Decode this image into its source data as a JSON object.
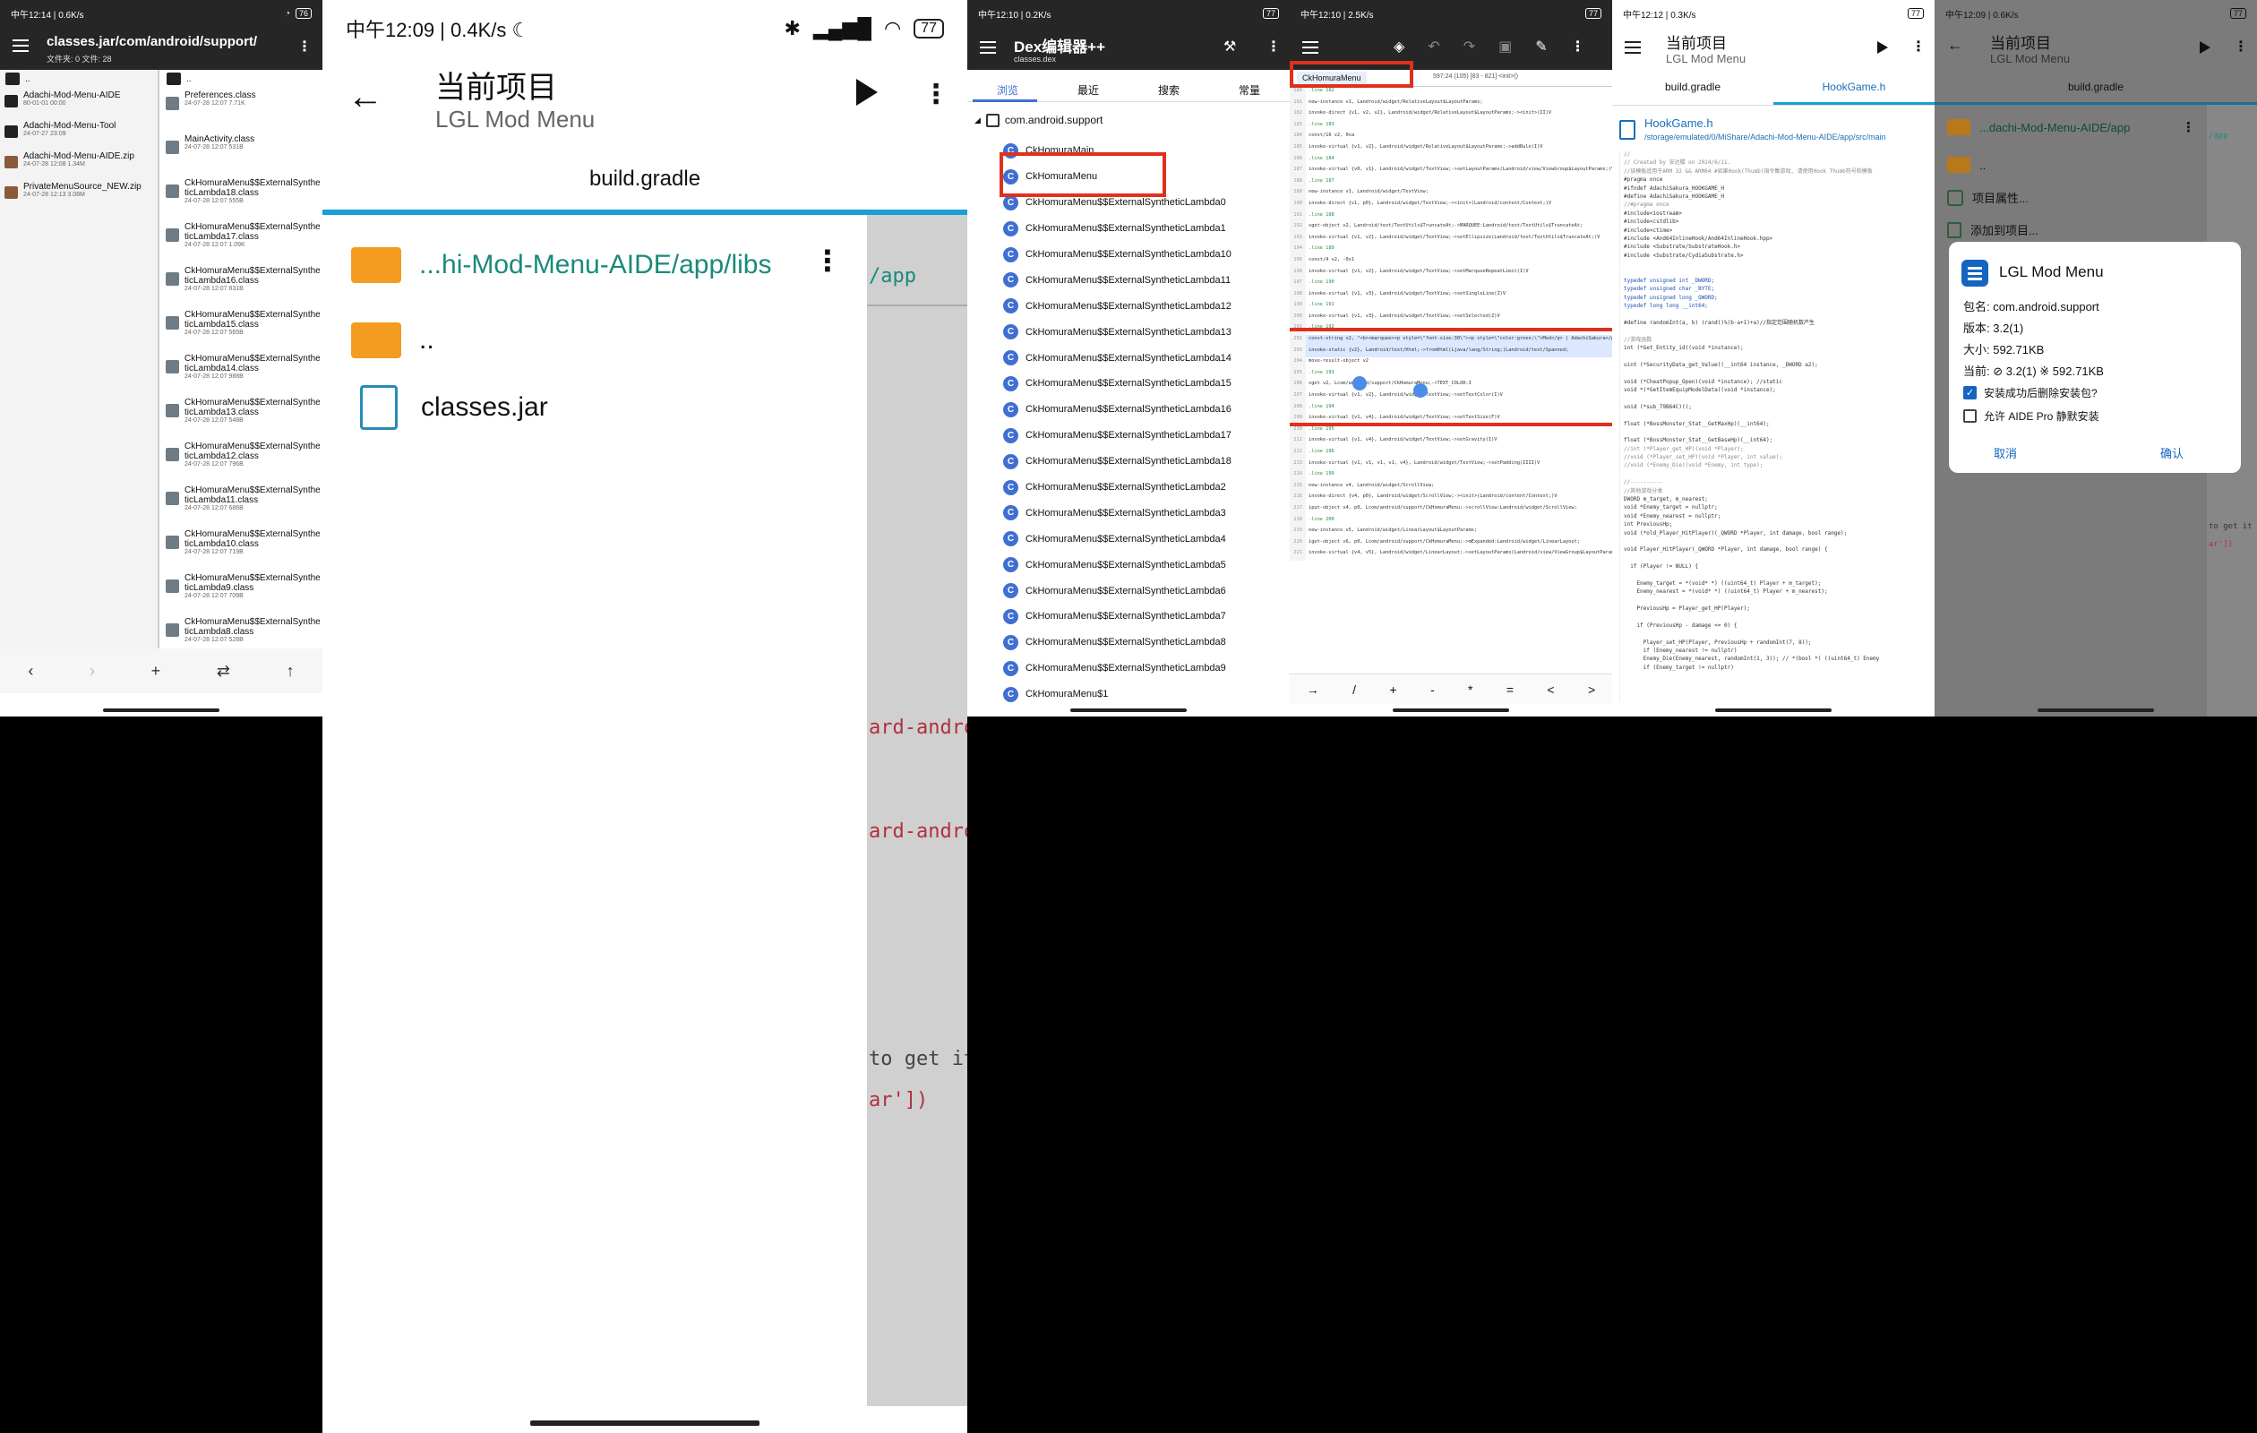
{
  "panel1": {
    "status": {
      "time": "中午12:14",
      "net": "0.6K/s",
      "battery": "76"
    },
    "toolbar": {
      "path": "classes.jar/com/android/support/",
      "subtitle": "文件夹: 0  文件: 28"
    },
    "left_pane": {
      "up": "..",
      "items": [
        {
          "name": "Adachi-Mod-Menu-AIDE",
          "meta": "80-01-01 00:00",
          "icon": "folder-icon"
        },
        {
          "name": "Adachi-Mod-Menu-Tool",
          "meta": "24-07-27 23:09",
          "icon": "folder-icon"
        },
        {
          "name": "Adachi-Mod-Menu-AIDE.zip",
          "meta": "24-07-28 12:08  1.34M",
          "icon": "zip-icon"
        },
        {
          "name": "PrivateMenuSource_NEW.zip",
          "meta": "24-07-28 12:13  3.08M",
          "icon": "zip-icon"
        }
      ]
    },
    "right_pane": {
      "up": "..",
      "items": [
        {
          "name": "Preferences.class",
          "meta": "24-07-28 12:07  7.71K"
        },
        {
          "name": "MainActivity.class",
          "meta": "24-07-28 12:07  531B"
        },
        {
          "name": "CkHomuraMenu$$ExternalSyntheticLambda18.class",
          "meta": "24-07-28 12:07  555B"
        },
        {
          "name": "CkHomuraMenu$$ExternalSyntheticLambda17.class",
          "meta": "24-07-28 12:07  1.09K"
        },
        {
          "name": "CkHomuraMenu$$ExternalSyntheticLambda16.class",
          "meta": "24-07-28 12:07  831B"
        },
        {
          "name": "CkHomuraMenu$$ExternalSyntheticLambda15.class",
          "meta": "24-07-28 12:07  565B"
        },
        {
          "name": "CkHomuraMenu$$ExternalSyntheticLambda14.class",
          "meta": "24-07-28 12:07  988B"
        },
        {
          "name": "CkHomuraMenu$$ExternalSyntheticLambda13.class",
          "meta": "24-07-28 12:07  548B"
        },
        {
          "name": "CkHomuraMenu$$ExternalSyntheticLambda12.class",
          "meta": "24-07-28 12:07  796B"
        },
        {
          "name": "CkHomuraMenu$$ExternalSyntheticLambda11.class",
          "meta": "24-07-28 12:07  686B"
        },
        {
          "name": "CkHomuraMenu$$ExternalSyntheticLambda10.class",
          "meta": "24-07-28 12:07  719B"
        },
        {
          "name": "CkHomuraMenu$$ExternalSyntheticLambda9.class",
          "meta": "24-07-28 12:07  709B"
        },
        {
          "name": "CkHomuraMenu$$ExternalSyntheticLambda8.class",
          "meta": "24-07-28 12:07  528B"
        }
      ]
    },
    "bottom": [
      "‹",
      "›",
      "+",
      "⇄",
      "↑"
    ]
  },
  "panel2": {
    "status": {
      "time": "中午12:09",
      "net": "0.4K/s",
      "battery": "77"
    },
    "title": "当前项目",
    "subtitle": "LGL Mod Menu",
    "tab": "build.gradle",
    "bg_lines": [
      {
        "text": "/app",
        "color": "#1a8a7a"
      },
      {
        "text": "ard-androi",
        "color": "#b03040"
      },
      {
        "text": "ard-androi",
        "color": "#b03040"
      },
      {
        "text": "to get it w",
        "color": "#444"
      },
      {
        "text": "ar'])",
        "color": "#b03040"
      }
    ],
    "dialog": {
      "path": "...hi-Mod-Menu-AIDE/app/libs",
      "up": "..",
      "file": "classes.jar"
    }
  },
  "panel3": {
    "status": {
      "time": "中午12:10",
      "net": "0.2K/s",
      "battery": "77"
    },
    "title": "Dex编辑器++",
    "subtitle": "classes.dex",
    "tabs": [
      "浏览",
      "最近",
      "搜索",
      "常量"
    ],
    "package": "com.android.support",
    "classes": [
      "CkHomuraMain",
      "CkHomuraMenu",
      "CkHomuraMenu$$ExternalSyntheticLambda0",
      "CkHomuraMenu$$ExternalSyntheticLambda1",
      "CkHomuraMenu$$ExternalSyntheticLambda10",
      "CkHomuraMenu$$ExternalSyntheticLambda11",
      "CkHomuraMenu$$ExternalSyntheticLambda12",
      "CkHomuraMenu$$ExternalSyntheticLambda13",
      "CkHomuraMenu$$ExternalSyntheticLambda14",
      "CkHomuraMenu$$ExternalSyntheticLambda15",
      "CkHomuraMenu$$ExternalSyntheticLambda16",
      "CkHomuraMenu$$ExternalSyntheticLambda17",
      "CkHomuraMenu$$ExternalSyntheticLambda18",
      "CkHomuraMenu$$ExternalSyntheticLambda2",
      "CkHomuraMenu$$ExternalSyntheticLambda3",
      "CkHomuraMenu$$ExternalSyntheticLambda4",
      "CkHomuraMenu$$ExternalSyntheticLambda5",
      "CkHomuraMenu$$ExternalSyntheticLambda6",
      "CkHomuraMenu$$ExternalSyntheticLambda7",
      "CkHomuraMenu$$ExternalSyntheticLambda8",
      "CkHomuraMenu$$ExternalSyntheticLambda9",
      "CkHomuraMenu$1"
    ]
  },
  "panel4": {
    "status": {
      "time": "中午12:10",
      "net": "2.5K/s",
      "battery": "77"
    },
    "file_tab": "CkHomuraMenu",
    "position": "597:24 (105)   [83 - 821]  <init>()",
    "code": [
      {
        "n": "180",
        "t": ".line 182"
      },
      {
        "n": "181",
        "t": "new-instance v1, Landroid/widget/RelativeLayout$LayoutParams;"
      },
      {
        "n": "182",
        "t": "invoke-direct {v1, v2, v2}, Landroid/widget/RelativeLayout$LayoutParams;-><init>(II)V"
      },
      {
        "n": "183",
        "t": ".line 183"
      },
      {
        "n": "184",
        "t": "const/16 v2, 0xa"
      },
      {
        "n": "185",
        "t": "invoke-virtual {v1, v2}, Landroid/widget/RelativeLayout$LayoutParams;->addRule(I)V"
      },
      {
        "n": "186",
        "t": ".line 184"
      },
      {
        "n": "187",
        "t": "invoke-virtual {v0, v1}, Landroid/widget/TextView;->setLayoutParams(Landroid/view/ViewGroup$LayoutParams;)V"
      },
      {
        "n": "188",
        "t": ".line 187"
      },
      {
        "n": "189",
        "t": "new-instance v1, Landroid/widget/TextView;"
      },
      {
        "n": "190",
        "t": "invoke-direct {v1, p0}, Landroid/widget/TextView;-><init>(Landroid/content/Context;)V"
      },
      {
        "n": "191",
        "t": ".line 188"
      },
      {
        "n": "192",
        "t": "sget-object v2, Landroid/text/TextUtils$TruncateAt;->MARQUEE:Landroid/text/TextUtils$TruncateAt;"
      },
      {
        "n": "193",
        "t": "invoke-virtual {v1, v2}, Landroid/widget/TextView;->setEllipsize(Landroid/text/TextUtils$TruncateAt;)V"
      },
      {
        "n": "194",
        "t": ".line 189"
      },
      {
        "n": "195",
        "t": "const/4 v2, -0x1"
      },
      {
        "n": "196",
        "t": "invoke-virtual {v1, v2}, Landroid/widget/TextView;->setMarqueeRepeatLimit(I)V"
      },
      {
        "n": "197",
        "t": ".line 190"
      },
      {
        "n": "198",
        "t": "invoke-virtual {v1, v3}, Landroid/widget/TextView;->setSingleLine(Z)V"
      },
      {
        "n": "199",
        "t": ".line 191"
      },
      {
        "n": "200",
        "t": "invoke-virtual {v1, v3}, Landroid/widget/TextView;->setSelected(Z)V"
      },
      {
        "n": "201",
        "t": ".line 192"
      },
      {
        "n": "202",
        "t": "const-string v2, \"<b><marquee><p style=\\\"font-size:30\\\"><p style=\\\"color:green;\\\">Mod</p> | AdachiSakura</p></marquee></b>\""
      },
      {
        "n": "203",
        "t": "invoke-static {v2}, Landroid/text/Html;->fromHtml(Ljava/lang/String;)Landroid/text/Spanned;"
      },
      {
        "n": "204",
        "t": "move-result-object v2"
      },
      {
        "n": "205",
        "t": ".line 193"
      },
      {
        "n": "206",
        "t": "sget v2, Lcom/android/support/CkHomuraMenu;->TEXT_COLOR:I"
      },
      {
        "n": "207",
        "t": "invoke-virtual {v1, v2}, Landroid/widget/TextView;->setTextColor(I)V"
      },
      {
        "n": "208",
        "t": ".line 194"
      },
      {
        "n": "209",
        "t": "invoke-virtual {v1, v4}, Landroid/widget/TextView;->setTextSize(F)V"
      },
      {
        "n": "210",
        "t": ".line 195"
      },
      {
        "n": "211",
        "t": "invoke-virtual {v1, v4}, Landroid/widget/TextView;->setGravity(I)V"
      },
      {
        "n": "212",
        "t": ".line 196"
      },
      {
        "n": "213",
        "t": "invoke-virtual {v1, v1, v1, v1, v4}, Landroid/widget/TextView;->setPadding(IIII)V"
      },
      {
        "n": "214",
        "t": ".line 199"
      },
      {
        "n": "215",
        "t": "new-instance v4, Landroid/widget/ScrollView;"
      },
      {
        "n": "216",
        "t": "invoke-direct {v4, p0}, Landroid/widget/ScrollView;-><init>(Landroid/content/Context;)V"
      },
      {
        "n": "217",
        "t": "iput-object v4, p0, Lcom/android/support/CkHomuraMenu;->scrollView:Landroid/widget/ScrollView;"
      },
      {
        "n": "218",
        "t": ".line 200"
      },
      {
        "n": "219",
        "t": "new-instance v5, Landroid/widget/LinearLayout$LayoutParams;"
      },
      {
        "n": "220",
        "t": "iget-object v6, p0, Lcom/android/support/CkHomuraMenu;->mExpanded:Landroid/widget/LinearLayout;"
      },
      {
        "n": "221",
        "t": "invoke-virtual {v4, v5}, Landroid/widget/LinearLayout;->setLayoutParams(Landroid/view/ViewGroup$LayoutParams;)V"
      }
    ],
    "keys": [
      "→",
      "/",
      "+",
      "-",
      "*",
      "=",
      "<",
      ">"
    ]
  },
  "panel5": {
    "status": {
      "time": "中午12:12",
      "net": "0.3K/s",
      "battery": "77"
    },
    "title": "当前项目",
    "subtitle": "LGL Mod Menu",
    "tabs": [
      "build.gradle",
      "HookGame.h"
    ],
    "file_name": "HookGame.h",
    "file_path": "/storage/emulated/0/MiShare/Adachi-Mod-Menu-AIDE/app/src/main",
    "code": [
      {
        "t": "//",
        "c": "#888"
      },
      {
        "t": "// Created by 安达樱 on 2024/6/11.",
        "c": "#888"
      },
      {
        "t": "//该模板适用于ARM 32 && ARM64 #如果Hook(Thumb)指令集游戏, 请使用Hook Thumb符号和模板",
        "c": "#888"
      },
      {
        "t": "#pragma once",
        "c": "#333"
      },
      {
        "t": "#ifndef AdachiSakura_HOOKGAME_H",
        "c": "#333"
      },
      {
        "t": "#define AdachiSakura_HOOKGAME_H",
        "c": "#333"
      },
      {
        "t": "//#pragma once",
        "c": "#888"
      },
      {
        "t": "#include<iostream>",
        "c": "#333"
      },
      {
        "t": "#include<cstdlib>",
        "c": "#333"
      },
      {
        "t": "#include<ctime>",
        "c": "#333"
      },
      {
        "t": "#include <And64InlineHook/And64InlineHook.hpp>",
        "c": "#333"
      },
      {
        "t": "#include <Substrate/SubstrateHook.h>",
        "c": "#333"
      },
      {
        "t": "#include <Substrate/CydiaSubstrate.h>",
        "c": "#333"
      },
      {
        "t": "",
        "c": "#333"
      },
      {
        "t": "",
        "c": "#333"
      },
      {
        "t": "typedef unsigned int _DWORD;",
        "c": "#1d4fb8"
      },
      {
        "t": "typedef unsigned char _BYTE;",
        "c": "#1d4fb8"
      },
      {
        "t": "typedef unsigned long _QWORD;",
        "c": "#1d4fb8"
      },
      {
        "t": "typedef long long __int64;",
        "c": "#1d4fb8"
      },
      {
        "t": "",
        "c": "#333"
      },
      {
        "t": "#define randomInt(a, b) (rand()%(b-a+1)+a)//指定范围随机数产生",
        "c": "#333"
      },
      {
        "t": "",
        "c": "#333"
      },
      {
        "t": "//游戏函数",
        "c": "#888"
      },
      {
        "t": "int (*Get_Entity_id)(void *instance);",
        "c": "#333"
      },
      {
        "t": "",
        "c": "#333"
      },
      {
        "t": "uint (*SecurityData_get_Value)(__int64 instance, _DWORD a2);",
        "c": "#333"
      },
      {
        "t": "",
        "c": "#333"
      },
      {
        "t": "void (*CheatPopup_Open)(void *instance); //static",
        "c": "#333"
      },
      {
        "t": "void *(*GetItemEquipModelData)(void *instance);",
        "c": "#333"
      },
      {
        "t": "",
        "c": "#333"
      },
      {
        "t": "void (*sub_79B64C)();",
        "c": "#333"
      },
      {
        "t": "",
        "c": "#333"
      },
      {
        "t": "float (*BossMonster_Stat__GetMaxHp)(__int64);",
        "c": "#333"
      },
      {
        "t": "",
        "c": "#333"
      },
      {
        "t": "float (*BossMonster_Stat__GetBaseHp)(__int64);",
        "c": "#333"
      },
      {
        "t": "//int (*Player_get_HP)(void *Player);",
        "c": "#888"
      },
      {
        "t": "//void (*Player_set_HP)(void *Player, int value);",
        "c": "#888"
      },
      {
        "t": "//void (*Enemy_Die)(void *Enemy, int type);",
        "c": "#888"
      },
      {
        "t": "",
        "c": "#333"
      },
      {
        "t": "//----------",
        "c": "#888"
      },
      {
        "t": "//其他游戏分类",
        "c": "#888"
      },
      {
        "t": "DWORD m_target, m_nearest;",
        "c": "#333"
      },
      {
        "t": "void *Enemy_target = nullptr;",
        "c": "#333"
      },
      {
        "t": "void *Enemy_nearest = nullptr;",
        "c": "#333"
      },
      {
        "t": "int PreviousHp;",
        "c": "#333"
      },
      {
        "t": "void (*old_Player_HitPlayer)(_QWORD *Player, int damage, bool range);",
        "c": "#333"
      },
      {
        "t": "",
        "c": "#333"
      },
      {
        "t": "void Player_HitPlayer(_QWORD *Player, int damage, bool range) {",
        "c": "#333"
      },
      {
        "t": "",
        "c": "#333"
      },
      {
        "t": "  if (Player != NULL) {",
        "c": "#333"
      },
      {
        "t": "",
        "c": "#333"
      },
      {
        "t": "    Enemy_target = *(void* *) ((uint64_t) Player + m_target);",
        "c": "#333"
      },
      {
        "t": "    Enemy_nearest = *(void* *) ((uint64_t) Player + m_nearest);",
        "c": "#333"
      },
      {
        "t": "",
        "c": "#333"
      },
      {
        "t": "    PreviousHp = Player_get_HP(Player);",
        "c": "#333"
      },
      {
        "t": "",
        "c": "#333"
      },
      {
        "t": "    if (PreviousHp - damage <= 0) {",
        "c": "#333"
      },
      {
        "t": "",
        "c": "#333"
      },
      {
        "t": "      Player_set_HP(Player, PreviousHp + randomInt(7, 8));",
        "c": "#333"
      },
      {
        "t": "      if (Enemy_nearest != nullptr)",
        "c": "#333"
      },
      {
        "t": "      Enemy_Die(Enemy_nearest, randomInt(1, 3)); // *(bool *) ((uint64_t) Enemy",
        "c": "#333"
      },
      {
        "t": "      if (Enemy_target != nullptr)",
        "c": "#333"
      }
    ]
  },
  "panel6": {
    "status": {
      "time": "中午12:09",
      "net": "0.6K/s",
      "battery": "77"
    },
    "title": "当前项目",
    "subtitle": "LGL Mod Menu",
    "tab": "build.gradle",
    "path": "...dachi-Mod-Menu-AIDE/app",
    "up": "..",
    "menu": [
      "项目属性...",
      "添加到项目..."
    ],
    "bg_code": [
      {
        "text": "/app",
        "color": "#1a8a7a"
      },
      {
        "text": "to get it w",
        "color": "#444"
      },
      {
        "text": "ar'])",
        "color": "#b03040"
      }
    ],
    "dialog": {
      "app_name": "LGL Mod Menu",
      "package": "包名: com.android.support",
      "version": "版本: 3.2(1)",
      "size": "大小: 592.71KB",
      "current": "当前: ⊘ 3.2(1) ※ 592.71KB",
      "check1": "安装成功后删除安装包?",
      "check2": "允许 AIDE Pro 静默安装",
      "cancel": "取消",
      "confirm": "确认"
    }
  }
}
